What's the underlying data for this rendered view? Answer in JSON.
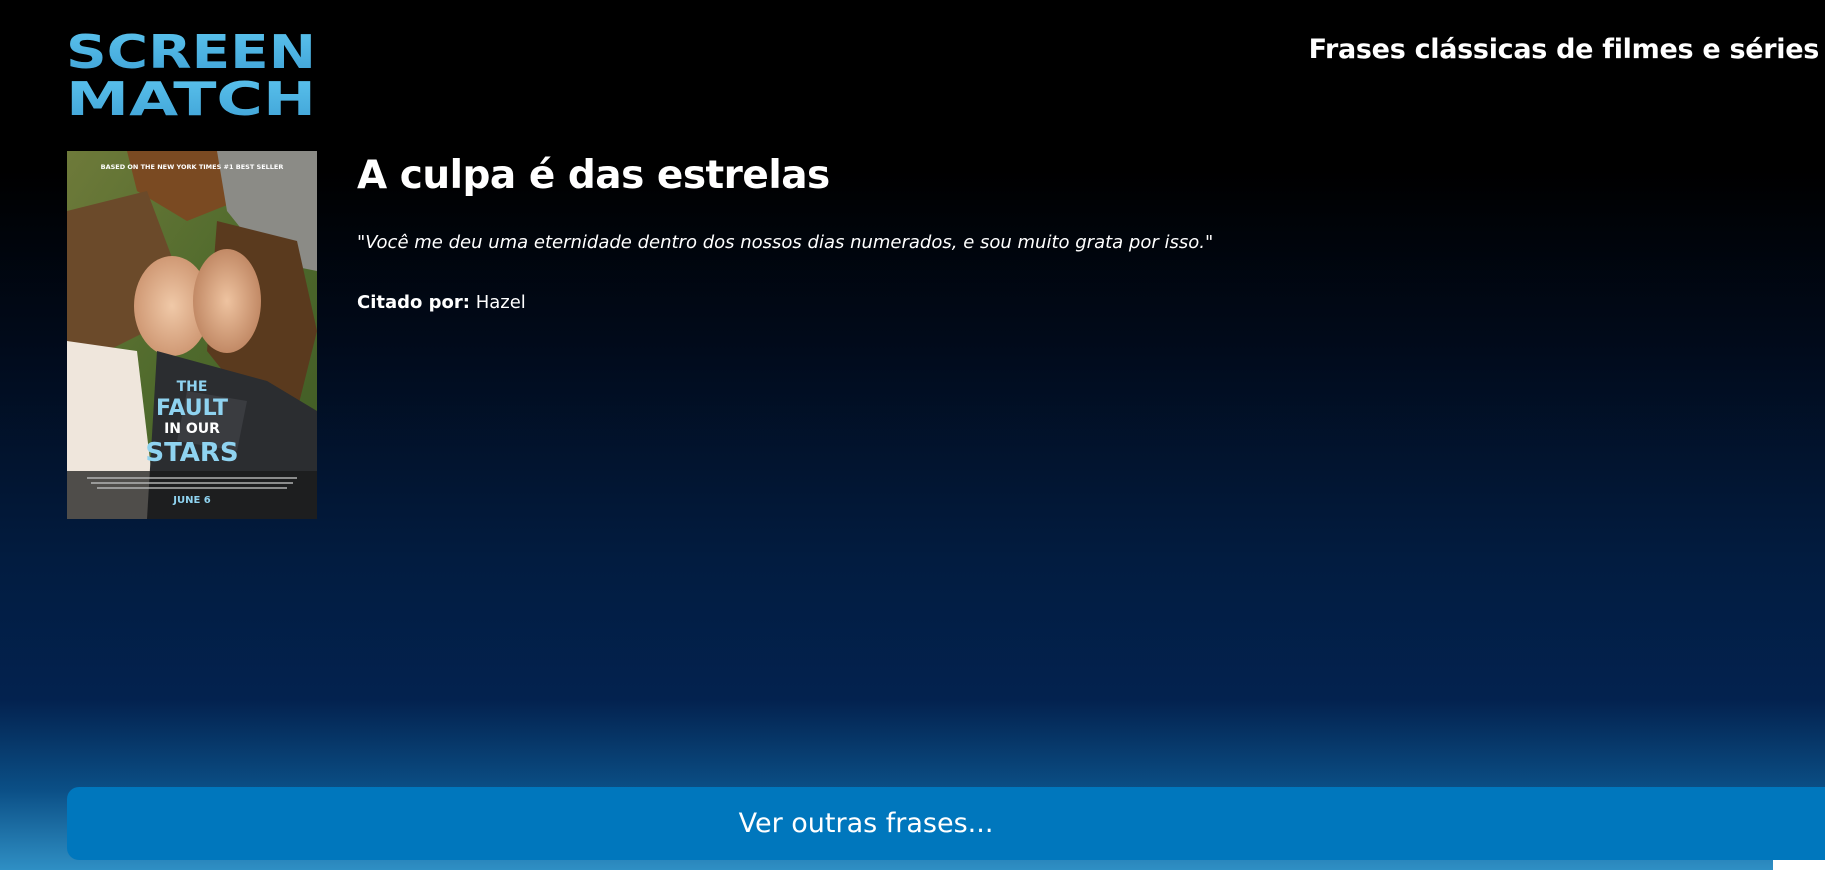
{
  "header": {
    "logo_line1": "SCREEN",
    "logo_line2": "MATCH",
    "title": "Frases clássicas de filmes e séries"
  },
  "poster": {
    "top_text": "BASED ON THE NEW YORK TIMES #1 BEST SELLER",
    "title_line1": "THE",
    "title_line2": "FAULT",
    "title_line3": "IN OUR",
    "title_line4": "STARS",
    "date": "JUNE 6"
  },
  "quote_card": {
    "movie_title": "A culpa é das estrelas",
    "quote": "\"Você me deu uma eternidade dentro dos nossos dias numerados, e sou muito grata por isso.\"",
    "cited_label": "Citado por:",
    "cited_name": "Hazel"
  },
  "actions": {
    "more_label": "Ver outras frases..."
  },
  "colors": {
    "logo": "#4cb6e6",
    "button": "#0077bd",
    "text": "#ffffff"
  }
}
